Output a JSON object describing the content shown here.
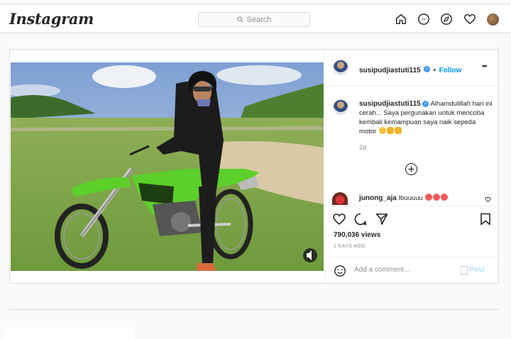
{
  "header": {
    "logo": "Instagram",
    "search_placeholder": "Search",
    "nav_icons": [
      "home-icon",
      "messenger-icon",
      "explore-icon",
      "heart-icon",
      "profile-avatar"
    ]
  },
  "post": {
    "username": "susipudjiastuti115",
    "follow_label": "Follow",
    "dot": "•",
    "more_label": "•••",
    "caption_text": "Alhamdulillah hari ini cerah... Saya pergunakan untuk mencoba kembali kemampuan saya naik sepeda motor",
    "caption_time": "2d",
    "comment": {
      "username": "junong_aja",
      "text": "Ibuuuuu"
    },
    "views": "790,036 views",
    "posted_ago": "2 DAYS AGO",
    "add_comment_placeholder": "Add a comment...",
    "post_label": "Post",
    "colors": {
      "accent": "#0095f6",
      "verified": "#3897f0",
      "bike_green": "#5ccf2a"
    }
  }
}
